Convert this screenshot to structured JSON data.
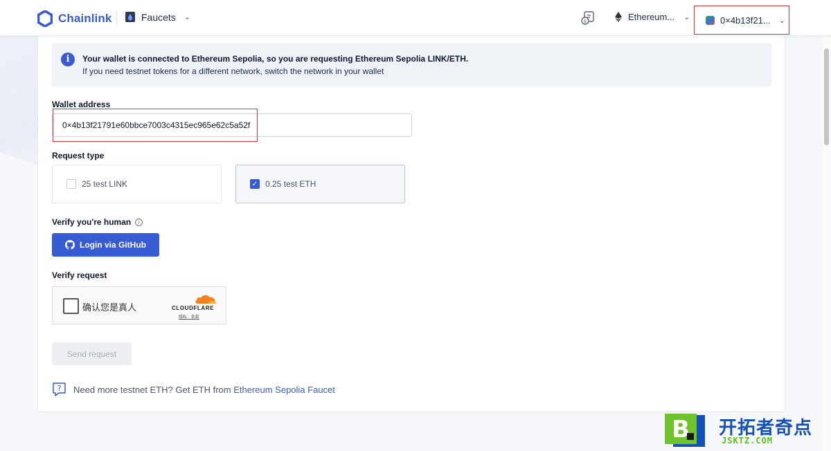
{
  "header": {
    "brand": "Chainlink",
    "nav_label": "Faucets",
    "network": "Ethereum...",
    "wallet": "0×4b13f21..."
  },
  "notice": {
    "line1": "Your wallet is connected to Ethereum Sepolia, so you are requesting Ethereum Sepolia LINK/ETH.",
    "line2": "If you need testnet tokens for a different network, switch the network in your wallet"
  },
  "form": {
    "wallet_label": "Wallet address",
    "wallet_value": "0×4b13f21791e60bbce7003c4315ec965e62c5a52f",
    "request_type_label": "Request type",
    "options": [
      {
        "label": "25 test LINK",
        "checked": false
      },
      {
        "label": "0.25 test ETH",
        "checked": true
      }
    ],
    "verify_human_label": "Verify you're human",
    "github_button": "Login via GitHub",
    "verify_request_label": "Verify request",
    "captcha_text": "确认您是真人",
    "captcha_brand": "CLOUDFLARE",
    "captcha_links": "隐私 · 条款",
    "send_button": "Send request"
  },
  "footer_prompt": {
    "text": "Need more testnet ETH? Get ETH from",
    "link": "Ethereum Sepolia Faucet"
  },
  "watermark": {
    "title": "开拓者奇点",
    "subtitle": "JSKTZ.COM"
  },
  "colors": {
    "accent": "#375bd2",
    "highlight_red": "#e03030"
  }
}
